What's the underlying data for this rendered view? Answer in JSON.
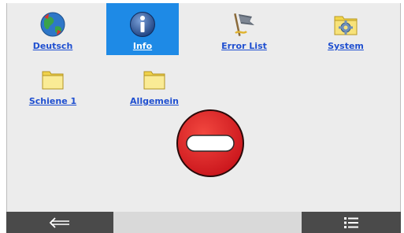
{
  "tiles": [
    {
      "label": "Deutsch",
      "icon": "globe-icon"
    },
    {
      "label": "Info",
      "icon": "info-icon",
      "selected": true
    },
    {
      "label": "Error List",
      "icon": "flag-icon"
    },
    {
      "label": "System",
      "icon": "gear-folder-icon"
    },
    {
      "label": "Schiene 1",
      "icon": "folder-icon"
    },
    {
      "label": "Allgemein",
      "icon": "folder-icon"
    }
  ],
  "status_icon": "no-entry-icon",
  "bottom_bar": {
    "back_icon": "back-arrow-icon",
    "menu_icon": "list-icon"
  },
  "colors": {
    "selected": "#1e8ae6",
    "link": "#1f4fd0",
    "stop": "#e3262b"
  }
}
